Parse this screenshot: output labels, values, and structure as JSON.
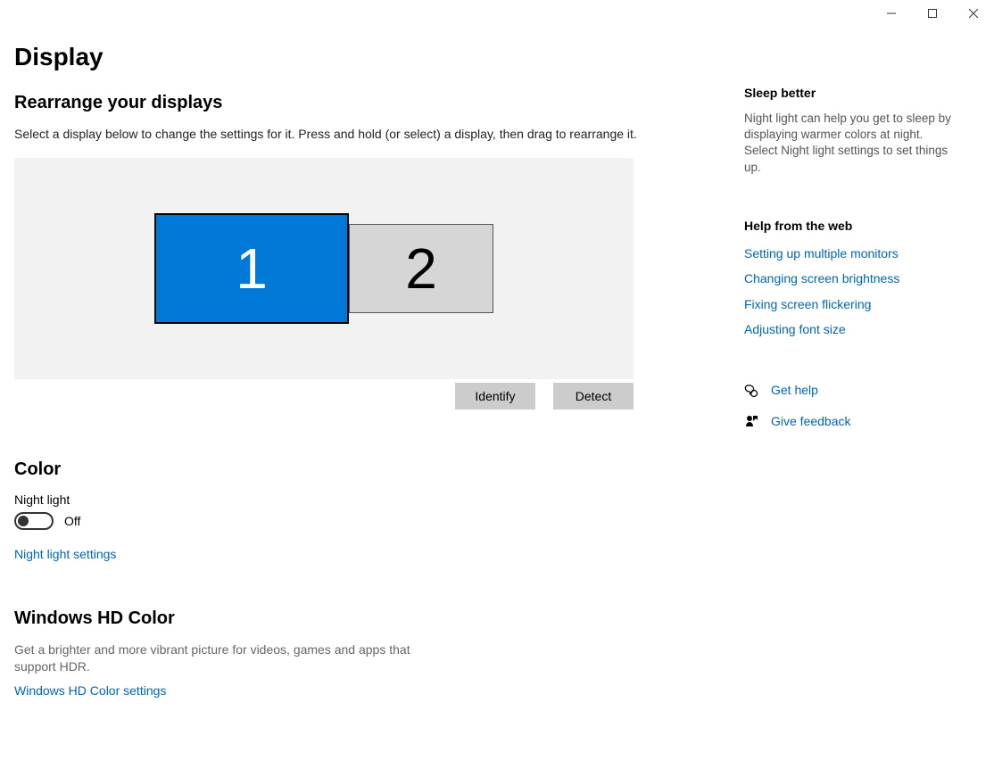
{
  "window": {
    "minimize_title": "Minimize",
    "maximize_title": "Maximize",
    "close_title": "Close"
  },
  "page": {
    "title": "Display"
  },
  "rearrange": {
    "heading": "Rearrange your displays",
    "description": "Select a display below to change the settings for it. Press and hold (or select) a display, then drag to rearrange it.",
    "monitor1": "1",
    "monitor2": "2",
    "identify": "Identify",
    "detect": "Detect"
  },
  "color": {
    "heading": "Color",
    "night_light_label": "Night light",
    "night_light_state": "Off",
    "night_light_settings": "Night light settings"
  },
  "hd": {
    "heading": "Windows HD Color",
    "description": "Get a brighter and more vibrant picture for videos, games and apps that support HDR.",
    "settings": "Windows HD Color settings"
  },
  "sidebar": {
    "sleep_heading": "Sleep better",
    "sleep_text": "Night light can help you get to sleep by displaying warmer colors at night. Select Night light settings to set things up.",
    "help_heading": "Help from the web",
    "links": {
      "0": "Setting up multiple monitors",
      "1": "Changing screen brightness",
      "2": "Fixing screen flickering",
      "3": "Adjusting font size"
    },
    "get_help": "Get help",
    "give_feedback": "Give feedback"
  }
}
